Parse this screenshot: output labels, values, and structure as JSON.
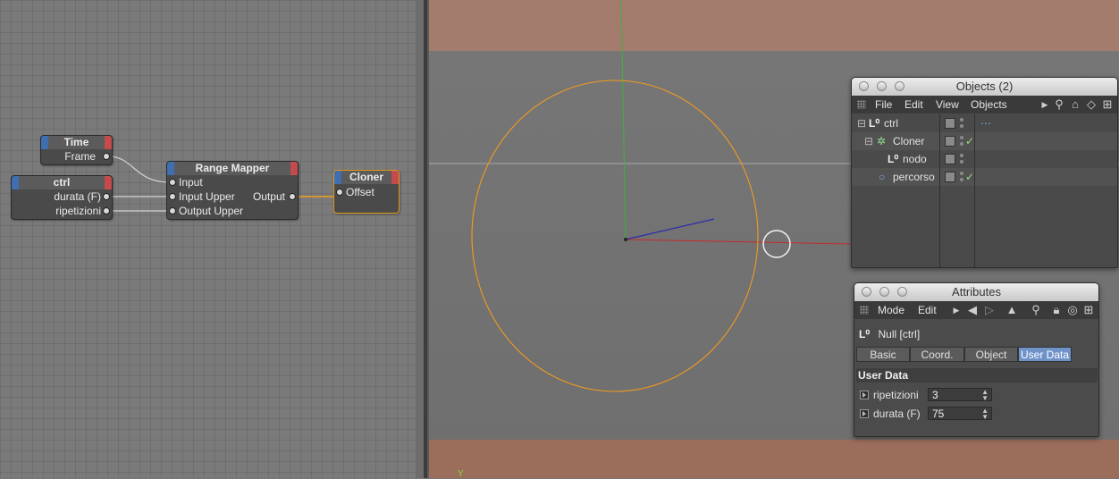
{
  "xpresso": {
    "nodes": {
      "time": {
        "title": "Time",
        "ports": {
          "frame": "Frame"
        }
      },
      "ctrl": {
        "title": "ctrl",
        "ports": {
          "durata": "durata (F)",
          "ripetizioni": "ripetizioni"
        }
      },
      "range_mapper": {
        "title": "Range Mapper",
        "inputs": [
          "Input",
          "Input Upper",
          "Output Upper"
        ],
        "output": "Output"
      },
      "cloner": {
        "title": "Cloner",
        "ports": {
          "offset": "Offset"
        }
      }
    }
  },
  "viewport": {
    "axis_label": "Y",
    "colors": {
      "circle": "#f39a1e",
      "x_axis": "#c62a2a",
      "y_axis": "#3db33d",
      "z_axis": "#2c2caa"
    }
  },
  "objects_window": {
    "title": "Objects (2)",
    "menu": [
      "File",
      "Edit",
      "View",
      "Objects"
    ],
    "items": [
      {
        "name": "ctrl",
        "icon": "null-icon",
        "checked": false
      },
      {
        "name": "Cloner",
        "icon": "cloner-icon",
        "checked": true
      },
      {
        "name": "nodo",
        "icon": "null-icon",
        "checked": false
      },
      {
        "name": "percorso",
        "icon": "circle-spline-icon",
        "checked": true
      }
    ],
    "check_mark": "✓"
  },
  "attributes_window": {
    "title": "Attributes",
    "menu": [
      "Mode",
      "Edit"
    ],
    "object_label": "Null [ctrl]",
    "tabs": [
      "Basic",
      "Coord.",
      "Object",
      "User Data"
    ],
    "active_tab": "User Data",
    "section_title": "User Data",
    "fields": [
      {
        "label": "ripetizioni",
        "value": "3"
      },
      {
        "label": "durata (F)",
        "value": "75"
      }
    ]
  }
}
